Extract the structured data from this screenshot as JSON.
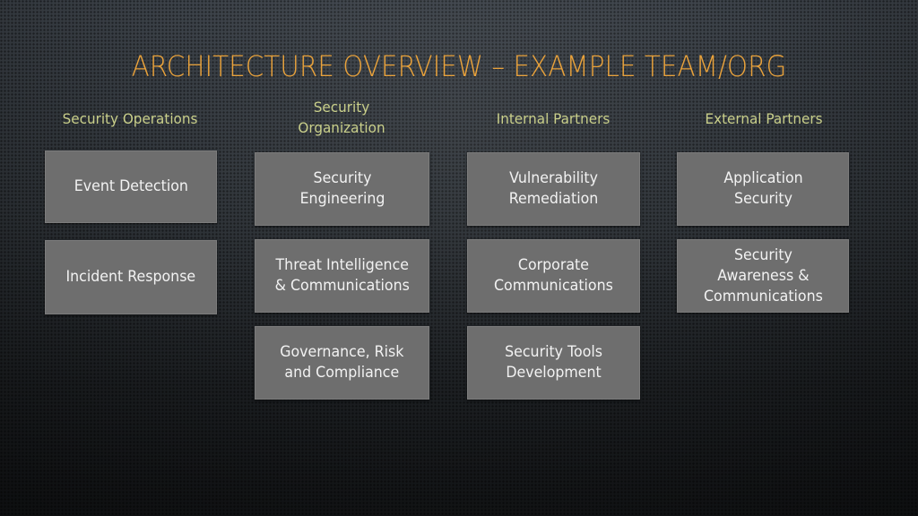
{
  "slide": {
    "title": "ARCHITECTURE OVERVIEW – EXAMPLE TEAM/ORG",
    "colors": {
      "title": "#e9a23b",
      "column_header": "#c9cf8a",
      "box_fill": "#6e6e6e",
      "box_text": "#f2f2f2"
    }
  },
  "columns": [
    {
      "header": "Security Operations",
      "boxes": [
        "Event Detection",
        "Incident Response"
      ]
    },
    {
      "header": "Security\nOrganization",
      "boxes": [
        "Security\nEngineering",
        "Threat Intelligence\n& Communications",
        "Governance, Risk\nand Compliance"
      ]
    },
    {
      "header": "Internal Partners",
      "boxes": [
        "Vulnerability\nRemediation",
        "Corporate\nCommunications",
        "Security Tools\nDevelopment"
      ]
    },
    {
      "header": "External Partners",
      "boxes": [
        "Application\nSecurity",
        "Security\nAwareness &\nCommunications"
      ]
    }
  ]
}
